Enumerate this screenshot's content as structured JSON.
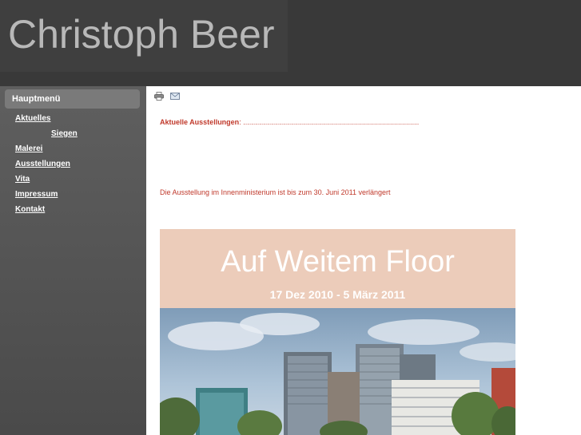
{
  "header": {
    "site_title": "Christoph Beer"
  },
  "sidebar": {
    "menu_title": "Hauptmenü",
    "items": [
      {
        "label": "Aktuelles"
      },
      {
        "label": "Siegen"
      },
      {
        "label": "Malerei"
      },
      {
        "label": "Ausstellungen"
      },
      {
        "label": "Vita"
      },
      {
        "label": "Impressum"
      },
      {
        "label": "Kontakt"
      }
    ]
  },
  "content": {
    "toolbar": {
      "print_icon": "printer-icon",
      "email_icon": "email-icon"
    },
    "ausstellungen_label": "Aktuelle Ausstellungen",
    "ausstellungen_separator": ":",
    "ausstellungen_dots": " ........................................................................................",
    "extension_note": "Die Ausstellung im Innenministerium ist bis zum 30. Juni 2011 verlängert",
    "poster": {
      "title": "Auf Weitem Floor",
      "dates": "17 Dez 2010 - 5 März 2011"
    }
  },
  "colors": {
    "header_bg": "#393939",
    "sidebar_bg": "#555555",
    "accent_text": "#c0392b",
    "poster_band": "#ecccba"
  }
}
